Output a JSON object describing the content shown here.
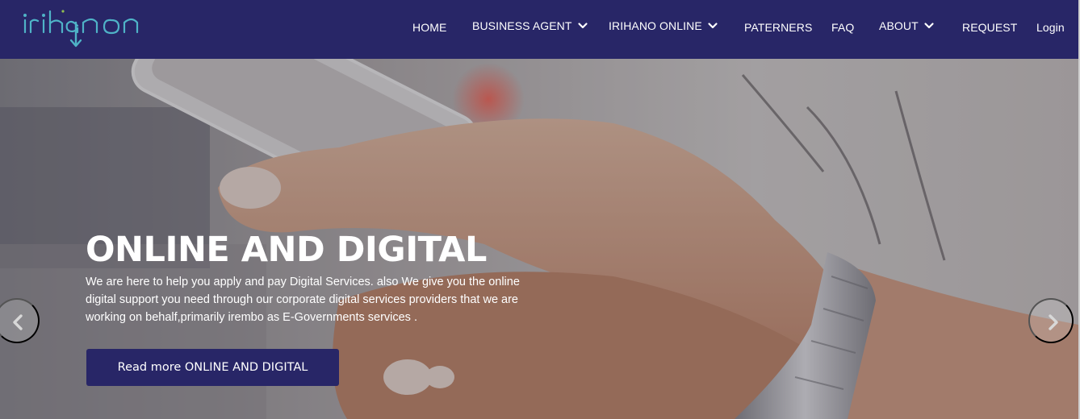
{
  "brand": {
    "logo_text": "irihano",
    "logo_icon": "down-arrow-icon",
    "colors": {
      "navbar": "#282667",
      "logo": "#4fb3c7"
    }
  },
  "nav": {
    "items": [
      {
        "label": "HOME",
        "dropdown": false
      },
      {
        "label": "BUSINESS AGENT",
        "dropdown": true
      },
      {
        "label": "IRIHANO ONLINE",
        "dropdown": true
      },
      {
        "label": "PATERNERS",
        "dropdown": false
      },
      {
        "label": "FAQ",
        "dropdown": false
      },
      {
        "label": "ABOUT",
        "dropdown": true
      },
      {
        "label": "REQUEST",
        "dropdown": false
      },
      {
        "label": "Login",
        "dropdown": false
      }
    ]
  },
  "hero": {
    "title": "ONLINE AND DIGITAL",
    "description": "We are here to help you apply and pay Digital Services. also We give you the online digital support you need through our corporate digital services providers that we are working on behalf,primarily irembo as E-Governments services .",
    "cta_label": "Read more ONLINE AND DIGITAL",
    "prev_icon": "chevron-left-icon",
    "next_icon": "chevron-right-icon",
    "image": "hands-holding-smartphone-photo"
  }
}
